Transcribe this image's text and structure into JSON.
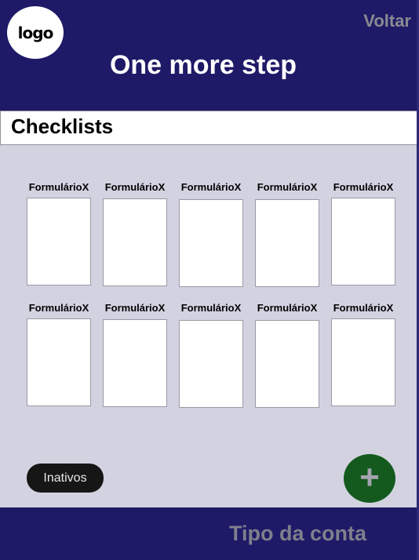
{
  "header": {
    "logo_text": "logo",
    "back_label": "Voltar",
    "title": "One more step"
  },
  "section": {
    "title": "Checklists"
  },
  "forms": {
    "row1": [
      "FormulárioX",
      "FormulárioX",
      "FormulárioX",
      "FormulárioX",
      "FormulárioX"
    ],
    "row2": [
      "FormulárioX",
      "FormulárioX",
      "FormulárioX",
      "FormulárioX",
      "FormulárioX"
    ]
  },
  "actions": {
    "inactive_label": "Inativos",
    "add_icon": "+"
  },
  "footer": {
    "account_type_label": "Tipo da conta"
  },
  "colors": {
    "header_bg": "#1f1a67",
    "content_bg": "#d2d2e0",
    "fab_bg": "#145a1e"
  }
}
